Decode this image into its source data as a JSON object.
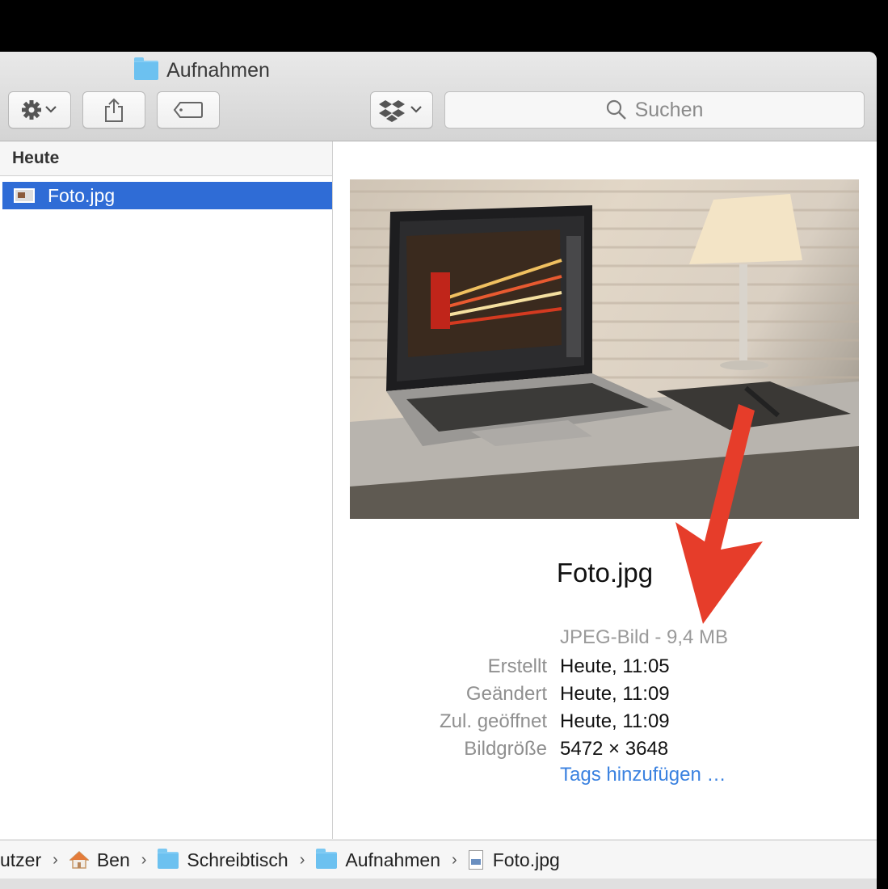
{
  "window": {
    "title": "Aufnahmen",
    "search_placeholder": "Suchen"
  },
  "sidebar": {
    "header": "Heute",
    "files": [
      "Foto.jpg"
    ]
  },
  "preview": {
    "name": "Foto.jpg",
    "kind": "JPEG-Bild - 9,4 MB",
    "meta": [
      {
        "label": "Erstellt",
        "value": "Heute, 11:05"
      },
      {
        "label": "Geändert",
        "value": "Heute, 11:09"
      },
      {
        "label": "Zul. geöffnet",
        "value": "Heute, 11:09"
      },
      {
        "label": "Bildgröße",
        "value": "5472 × 3648"
      }
    ],
    "tags_link": "Tags hinzufügen …"
  },
  "path": [
    "utzer",
    "Ben",
    "Schreibtisch",
    "Aufnahmen",
    "Foto.jpg"
  ],
  "colors": {
    "selection": "#2f6cd6",
    "link": "#3b82e0",
    "annotation_arrow": "#e63d2a"
  }
}
